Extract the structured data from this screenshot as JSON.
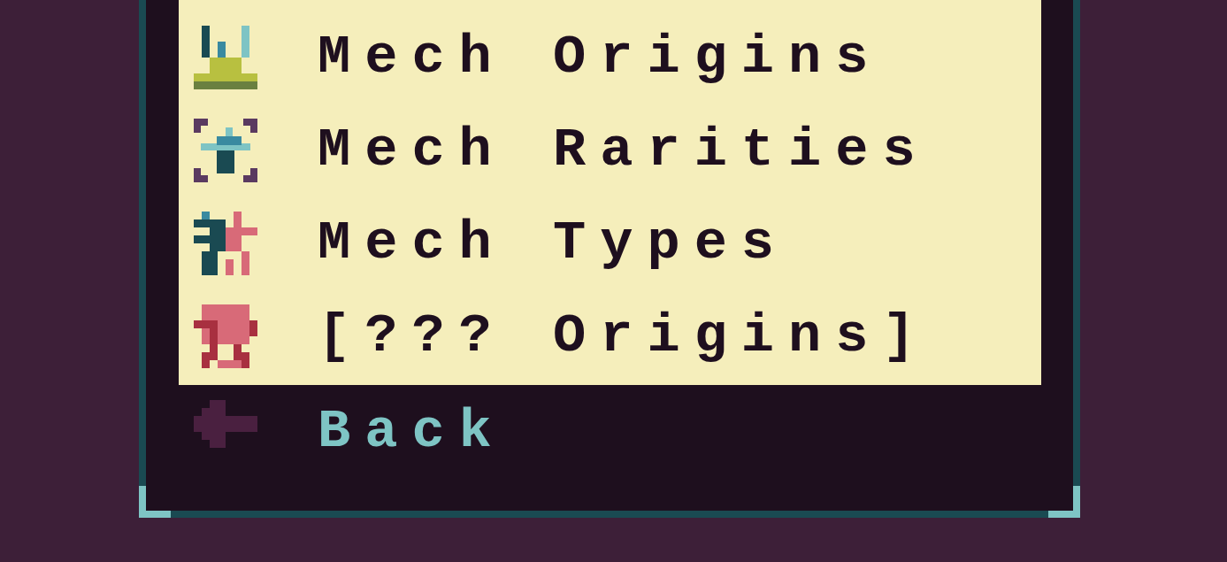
{
  "menu_items": [
    {
      "label": "Mech Origins"
    },
    {
      "label": "Mech Rarities"
    },
    {
      "label": "Mech Types"
    },
    {
      "label": "[??? Origins]"
    }
  ],
  "back_button": {
    "label": "Back"
  }
}
